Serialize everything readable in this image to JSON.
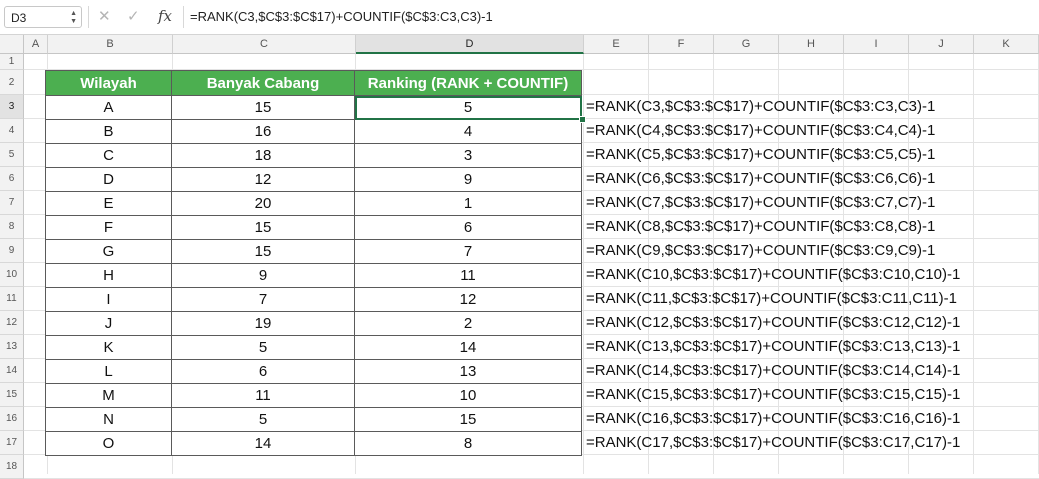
{
  "formula_bar": {
    "cell_ref": "D3",
    "cancel_icon": "✕",
    "enter_icon": "✓",
    "fx_label": "fx",
    "formula": "=RANK(C3,$C$3:$C$17)+COUNTIF($C$3:C3,C3)-1"
  },
  "columns": [
    "A",
    "B",
    "C",
    "D",
    "E",
    "F",
    "G",
    "H",
    "I",
    "J",
    "K"
  ],
  "rows": [
    "1",
    "2",
    "3",
    "4",
    "5",
    "6",
    "7",
    "8",
    "9",
    "10",
    "11",
    "12",
    "13",
    "14",
    "15",
    "16",
    "17",
    "18"
  ],
  "selected_column": "D",
  "selected_row": "3",
  "table": {
    "headers": [
      "Wilayah",
      "Banyak Cabang",
      "Ranking (RANK + COUNTIF)"
    ],
    "rows": [
      [
        "A",
        "15",
        "5"
      ],
      [
        "B",
        "16",
        "4"
      ],
      [
        "C",
        "18",
        "3"
      ],
      [
        "D",
        "12",
        "9"
      ],
      [
        "E",
        "20",
        "1"
      ],
      [
        "F",
        "15",
        "6"
      ],
      [
        "G",
        "15",
        "7"
      ],
      [
        "H",
        "9",
        "11"
      ],
      [
        "I",
        "7",
        "12"
      ],
      [
        "J",
        "19",
        "2"
      ],
      [
        "K",
        "5",
        "14"
      ],
      [
        "L",
        "6",
        "13"
      ],
      [
        "M",
        "11",
        "10"
      ],
      [
        "N",
        "5",
        "15"
      ],
      [
        "O",
        "14",
        "8"
      ]
    ]
  },
  "formulas": [
    "=RANK(C3,$C$3:$C$17)+COUNTIF($C$3:C3,C3)-1",
    "=RANK(C4,$C$3:$C$17)+COUNTIF($C$3:C4,C4)-1",
    "=RANK(C5,$C$3:$C$17)+COUNTIF($C$3:C5,C5)-1",
    "=RANK(C6,$C$3:$C$17)+COUNTIF($C$3:C6,C6)-1",
    "=RANK(C7,$C$3:$C$17)+COUNTIF($C$3:C7,C7)-1",
    "=RANK(C8,$C$3:$C$17)+COUNTIF($C$3:C8,C8)-1",
    "=RANK(C9,$C$3:$C$17)+COUNTIF($C$3:C9,C9)-1",
    "=RANK(C10,$C$3:$C$17)+COUNTIF($C$3:C10,C10)-1",
    "=RANK(C11,$C$3:$C$17)+COUNTIF($C$3:C11,C11)-1",
    "=RANK(C12,$C$3:$C$17)+COUNTIF($C$3:C12,C12)-1",
    "=RANK(C13,$C$3:$C$17)+COUNTIF($C$3:C13,C13)-1",
    "=RANK(C14,$C$3:$C$17)+COUNTIF($C$3:C14,C14)-1",
    "=RANK(C15,$C$3:$C$17)+COUNTIF($C$3:C15,C15)-1",
    "=RANK(C16,$C$3:$C$17)+COUNTIF($C$3:C16,C16)-1",
    "=RANK(C17,$C$3:$C$17)+COUNTIF($C$3:C17,C17)-1"
  ],
  "colors": {
    "header_fill": "#4caf50",
    "selection": "#217346"
  }
}
